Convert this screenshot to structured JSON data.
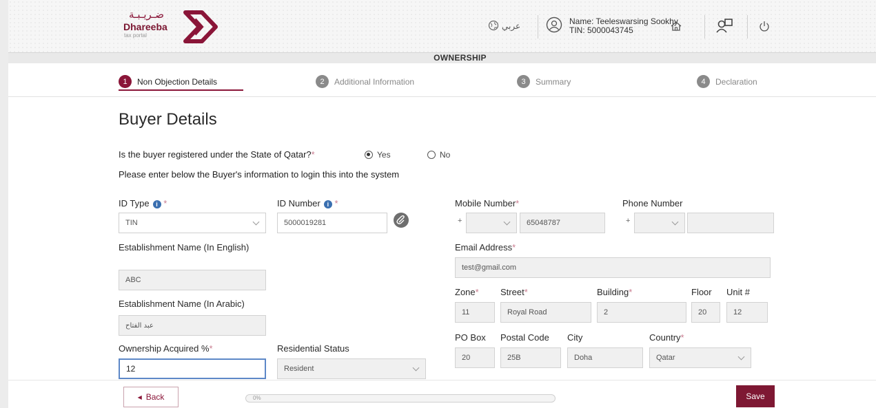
{
  "header": {
    "logo_arabic": "ضـريـبـة",
    "logo_name": "Dhareeba",
    "logo_sub": "tax portal",
    "language_label": "عربي",
    "user_name": "Name: Teeleswarsing Sookhy",
    "user_tin": "TIN: 5000043745"
  },
  "page_title": "OWNERSHIP",
  "steps": [
    {
      "num": "1",
      "label": "Non Objection Details"
    },
    {
      "num": "2",
      "label": "Additional Information"
    },
    {
      "num": "3",
      "label": "Summary"
    },
    {
      "num": "4",
      "label": "Declaration"
    }
  ],
  "section_title": "Buyer Details",
  "question": {
    "text": "Is the buyer registered under the State of Qatar?",
    "yes": "Yes",
    "no": "No",
    "selected": "Yes"
  },
  "instruction": "Please enter below the Buyer's information to login this into the system",
  "form": {
    "id_type": {
      "label": "ID Type",
      "value": "TIN"
    },
    "id_number": {
      "label": "ID Number",
      "value": "5000019281"
    },
    "est_name_en": {
      "label": "Establishment Name (In English)",
      "value": "ABC"
    },
    "est_name_ar": {
      "label": "Establishment Name (In Arabic)",
      "value": "عبد الفتاح"
    },
    "ownership": {
      "label": "Ownership Acquired %",
      "value": "12"
    },
    "residential": {
      "label": "Residential Status",
      "value": "Resident"
    },
    "mobile": {
      "label": "Mobile Number",
      "prefix": "+",
      "value": "65048787"
    },
    "phone": {
      "label": "Phone Number",
      "prefix": "+",
      "value": ""
    },
    "email": {
      "label": "Email Address",
      "value": "test@gmail.com"
    },
    "zone": {
      "label": "Zone",
      "value": "11"
    },
    "street": {
      "label": "Street",
      "value": "Royal Road"
    },
    "building": {
      "label": "Building",
      "value": "2"
    },
    "floor": {
      "label": "Floor",
      "value": "20"
    },
    "unit": {
      "label": "Unit #",
      "value": "12"
    },
    "pobox": {
      "label": "PO Box",
      "value": "20"
    },
    "postal": {
      "label": "Postal Code",
      "value": "25B"
    },
    "city": {
      "label": "City",
      "value": "Doha"
    },
    "country": {
      "label": "Country",
      "value": "Qatar"
    }
  },
  "footer": {
    "back": "Back",
    "progress": "0%",
    "save": "Save"
  },
  "colors": {
    "brand": "#8a1538",
    "info": "#3a6fb0",
    "focus": "#5c87c7"
  }
}
